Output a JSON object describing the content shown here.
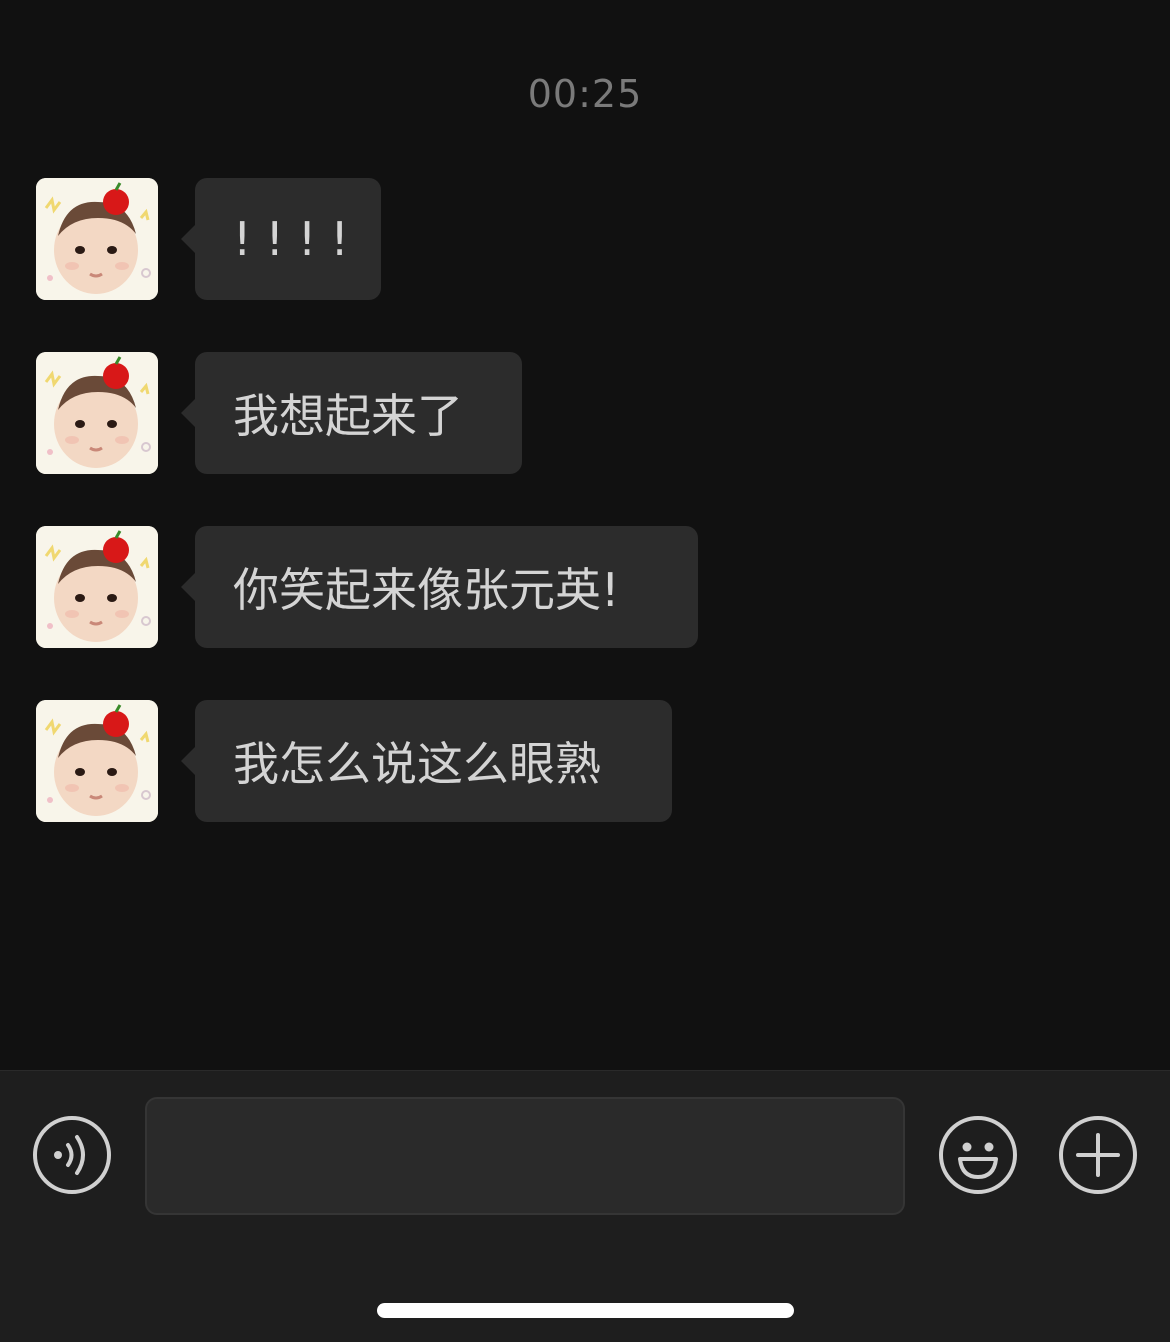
{
  "conversation": {
    "timestamp": "00:25",
    "messages": [
      {
        "sender": "contact",
        "text": "!!!!"
      },
      {
        "sender": "contact",
        "text": "我想起来了"
      },
      {
        "sender": "contact",
        "text": "你笑起来像张元英!"
      },
      {
        "sender": "contact",
        "text": "我怎么说这么眼熟"
      }
    ]
  },
  "input_bar": {
    "text_value": "",
    "voice_icon": "voice-icon",
    "emoji_icon": "emoji-icon",
    "more_icon": "plus-icon"
  },
  "colors": {
    "background": "#111111",
    "bubble": "#2c2c2c",
    "toolbar": "#1e1e1e",
    "text": "#d4d4d4",
    "timestamp": "#7a7a7a"
  }
}
